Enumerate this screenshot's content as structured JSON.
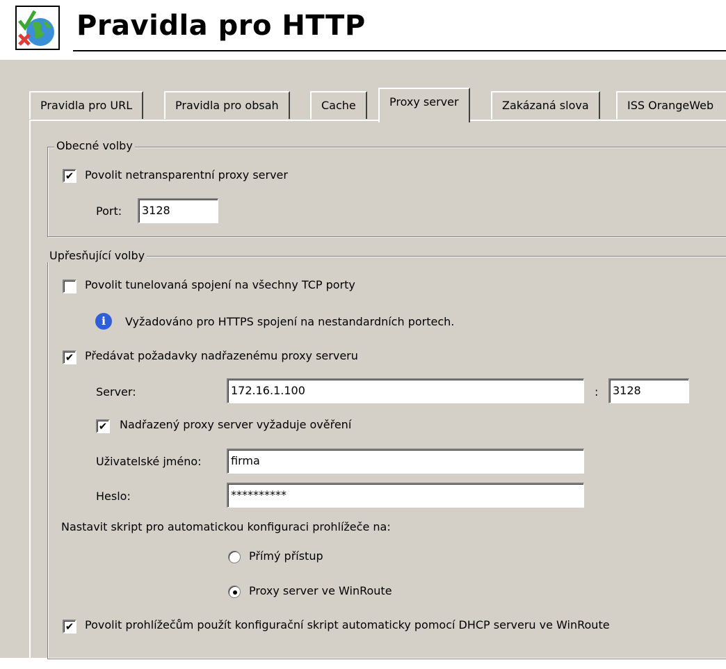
{
  "header": {
    "title": "Pravidla pro HTTP",
    "icon": "globe-check-icon"
  },
  "tabs": [
    {
      "label": "Pravidla pro URL"
    },
    {
      "label": "Pravidla pro obsah"
    },
    {
      "label": "Cache"
    },
    {
      "label": "Proxy server",
      "active": true
    },
    {
      "label": "Zakázaná slova"
    },
    {
      "label": "ISS OrangeWeb"
    }
  ],
  "general": {
    "legend": "Obecné volby",
    "enable_proxy": {
      "label": "Povolit netransparentní proxy server",
      "checked": "✔"
    },
    "port_label": "Port:",
    "port_value": "3128"
  },
  "advanced": {
    "legend": "Upřesňující volby",
    "tunnel": {
      "label": "Povolit tunelovaná spojení na všechny TCP porty",
      "checked": ""
    },
    "info_text": "Vyžadováno pro HTTPS spojení na nestandardních portech.",
    "forward": {
      "label": "Předávat požadavky nadřazenému proxy serveru",
      "checked": "✔"
    },
    "server_label": "Server:",
    "server_value": "172.16.1.100",
    "colon": ":",
    "server_port": "3128",
    "auth": {
      "label": "Nadřazený proxy server vyžaduje ověření",
      "checked": "✔"
    },
    "username_label": "Uživatelské jméno:",
    "username_value": "firma",
    "password_label": "Heslo:",
    "password_value": "**********",
    "script_label": "Nastavit skript pro automatickou konfiguraci prohlížeče na:",
    "radio_direct": "Přímý přístup",
    "radio_proxy": "Proxy server ve WinRoute",
    "dhcp": {
      "label": "Povolit prohlížečům použít konfigurační skript automaticky pomocí DHCP serveru ve WinRoute",
      "checked": "✔"
    }
  },
  "colors": {
    "panel": "#d4d0c8",
    "info_icon": "#2f5fd6"
  }
}
